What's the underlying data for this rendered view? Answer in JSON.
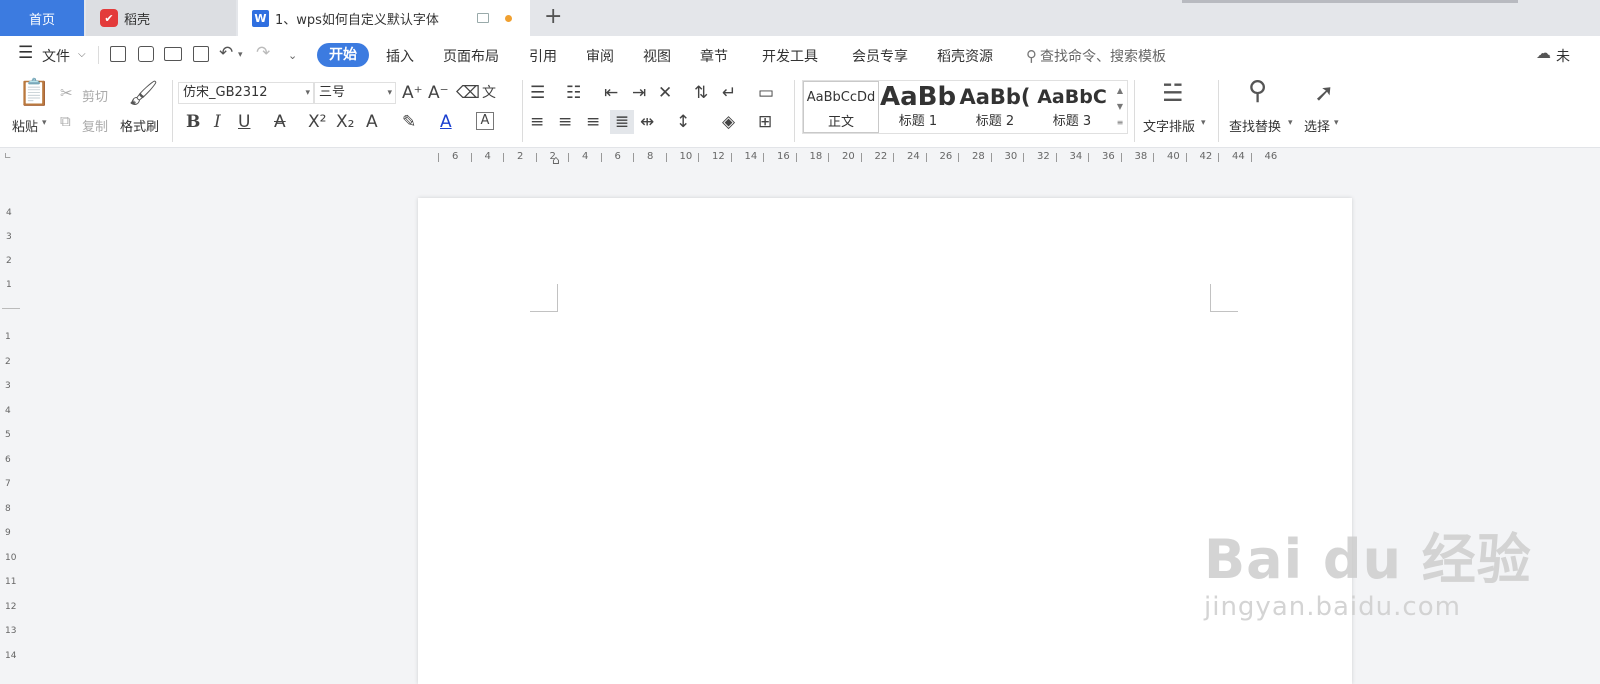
{
  "tabs": {
    "home": "首页",
    "daoke": "稻壳",
    "doc": "1、wps如何自定义默认字体",
    "doc_icon": "W"
  },
  "menubar": {
    "file": "文件",
    "items": [
      "开始",
      "插入",
      "页面布局",
      "引用",
      "审阅",
      "视图",
      "章节",
      "开发工具",
      "会员专享",
      "稻壳资源"
    ],
    "search_placeholder": "查找命令、搜索模板",
    "right_text": "未"
  },
  "ribbon": {
    "paste": "粘贴",
    "cut": "剪切",
    "copy": "复制",
    "format_painter": "格式刷",
    "font_name": "仿宋_GB2312",
    "font_size": "三号",
    "styles": [
      {
        "sample": "AaBbCcDd",
        "name": "正文"
      },
      {
        "sample": "AaBb",
        "name": "标题 1"
      },
      {
        "sample": "AaBb(",
        "name": "标题 2"
      },
      {
        "sample": "AaBbC",
        "name": "标题 3"
      }
    ],
    "text_layout": "文字排版",
    "find_replace": "查找替换",
    "select": "选择"
  },
  "ruler": {
    "h_labels": [
      "6",
      "4",
      "2",
      "2",
      "4",
      "6",
      "8",
      "10",
      "12",
      "14",
      "16",
      "18",
      "20",
      "22",
      "24",
      "26",
      "28",
      "30",
      "32",
      "34",
      "36",
      "38",
      "40",
      "42",
      "44",
      "46"
    ],
    "v_labels_top": [
      "4",
      "3",
      "2",
      "1"
    ],
    "v_labels": [
      "1",
      "2",
      "3",
      "4",
      "5",
      "6",
      "7",
      "8",
      "9",
      "10",
      "11",
      "12",
      "13",
      "14"
    ]
  },
  "watermark": {
    "main": "Bai du 经验",
    "sub": "jingyan.baidu.com"
  },
  "colors": {
    "accent": "#3c7be0",
    "tabbar": "#e4e6ea",
    "workspace": "#f3f4f6"
  }
}
